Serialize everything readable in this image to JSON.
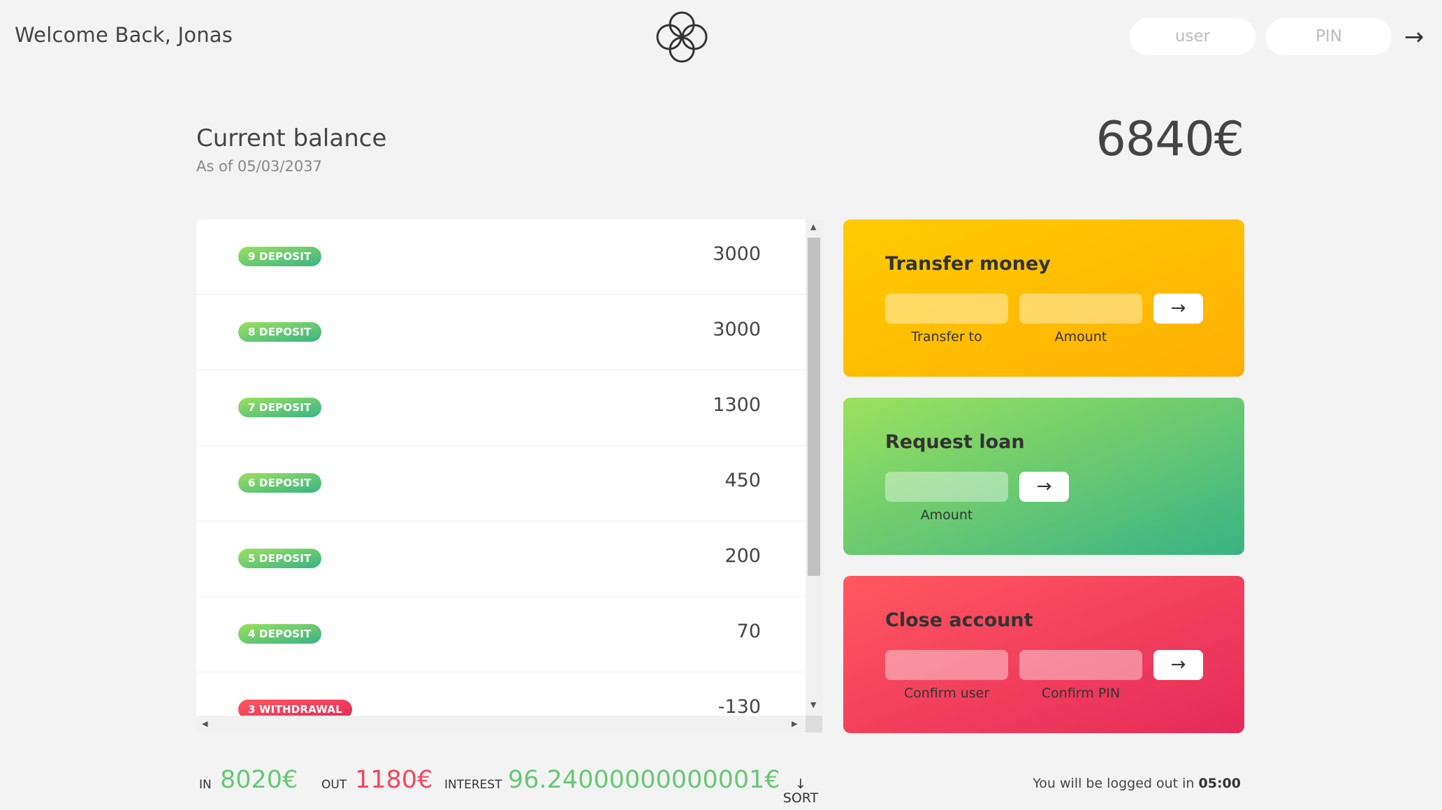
{
  "nav": {
    "welcome": "Welcome Back, Jonas",
    "logo_icon": "four-circle-flower-logo",
    "user_placeholder": "user",
    "pin_placeholder": "PIN",
    "login_arrow": "→"
  },
  "balance": {
    "label": "Current balance",
    "date": "As of 05/03/2037",
    "value": "6840€"
  },
  "movements": [
    {
      "badge": "9 deposit",
      "type": "deposit",
      "amount": "3000"
    },
    {
      "badge": "8 deposit",
      "type": "deposit",
      "amount": "3000"
    },
    {
      "badge": "7 deposit",
      "type": "deposit",
      "amount": "1300"
    },
    {
      "badge": "6 deposit",
      "type": "deposit",
      "amount": "450"
    },
    {
      "badge": "5 deposit",
      "type": "deposit",
      "amount": "200"
    },
    {
      "badge": "4 deposit",
      "type": "deposit",
      "amount": "70"
    },
    {
      "badge": "3 withdrawal",
      "type": "withdrawal",
      "amount": "-130"
    }
  ],
  "operations": {
    "transfer": {
      "title": "Transfer money",
      "label_to": "Transfer to",
      "label_amount": "Amount",
      "button": "→"
    },
    "loan": {
      "title": "Request loan",
      "label_amount": "Amount",
      "button": "→"
    },
    "close": {
      "title": "Close account",
      "label_user": "Confirm user",
      "label_pin": "Confirm PIN",
      "button": "→"
    }
  },
  "summary": {
    "in_label": "In",
    "in_value": "8020€",
    "out_label": "Out",
    "out_value": "1180€",
    "interest_label": "Interest",
    "interest_value": "96.24000000000001€",
    "sort_arrow": "↓",
    "sort_label": "SORT"
  },
  "logout": {
    "text": "You will be logged out in ",
    "time": "05:00"
  },
  "colors": {
    "background": "#f3f3f3",
    "deposit": "#66c873",
    "withdrawal": "#f5465d",
    "transfer_gradient": [
      "#ffcb03",
      "#ffb003"
    ],
    "loan_gradient": [
      "#9be15d",
      "#39b385"
    ],
    "close_gradient": [
      "#ff585f",
      "#e52a5a"
    ]
  }
}
